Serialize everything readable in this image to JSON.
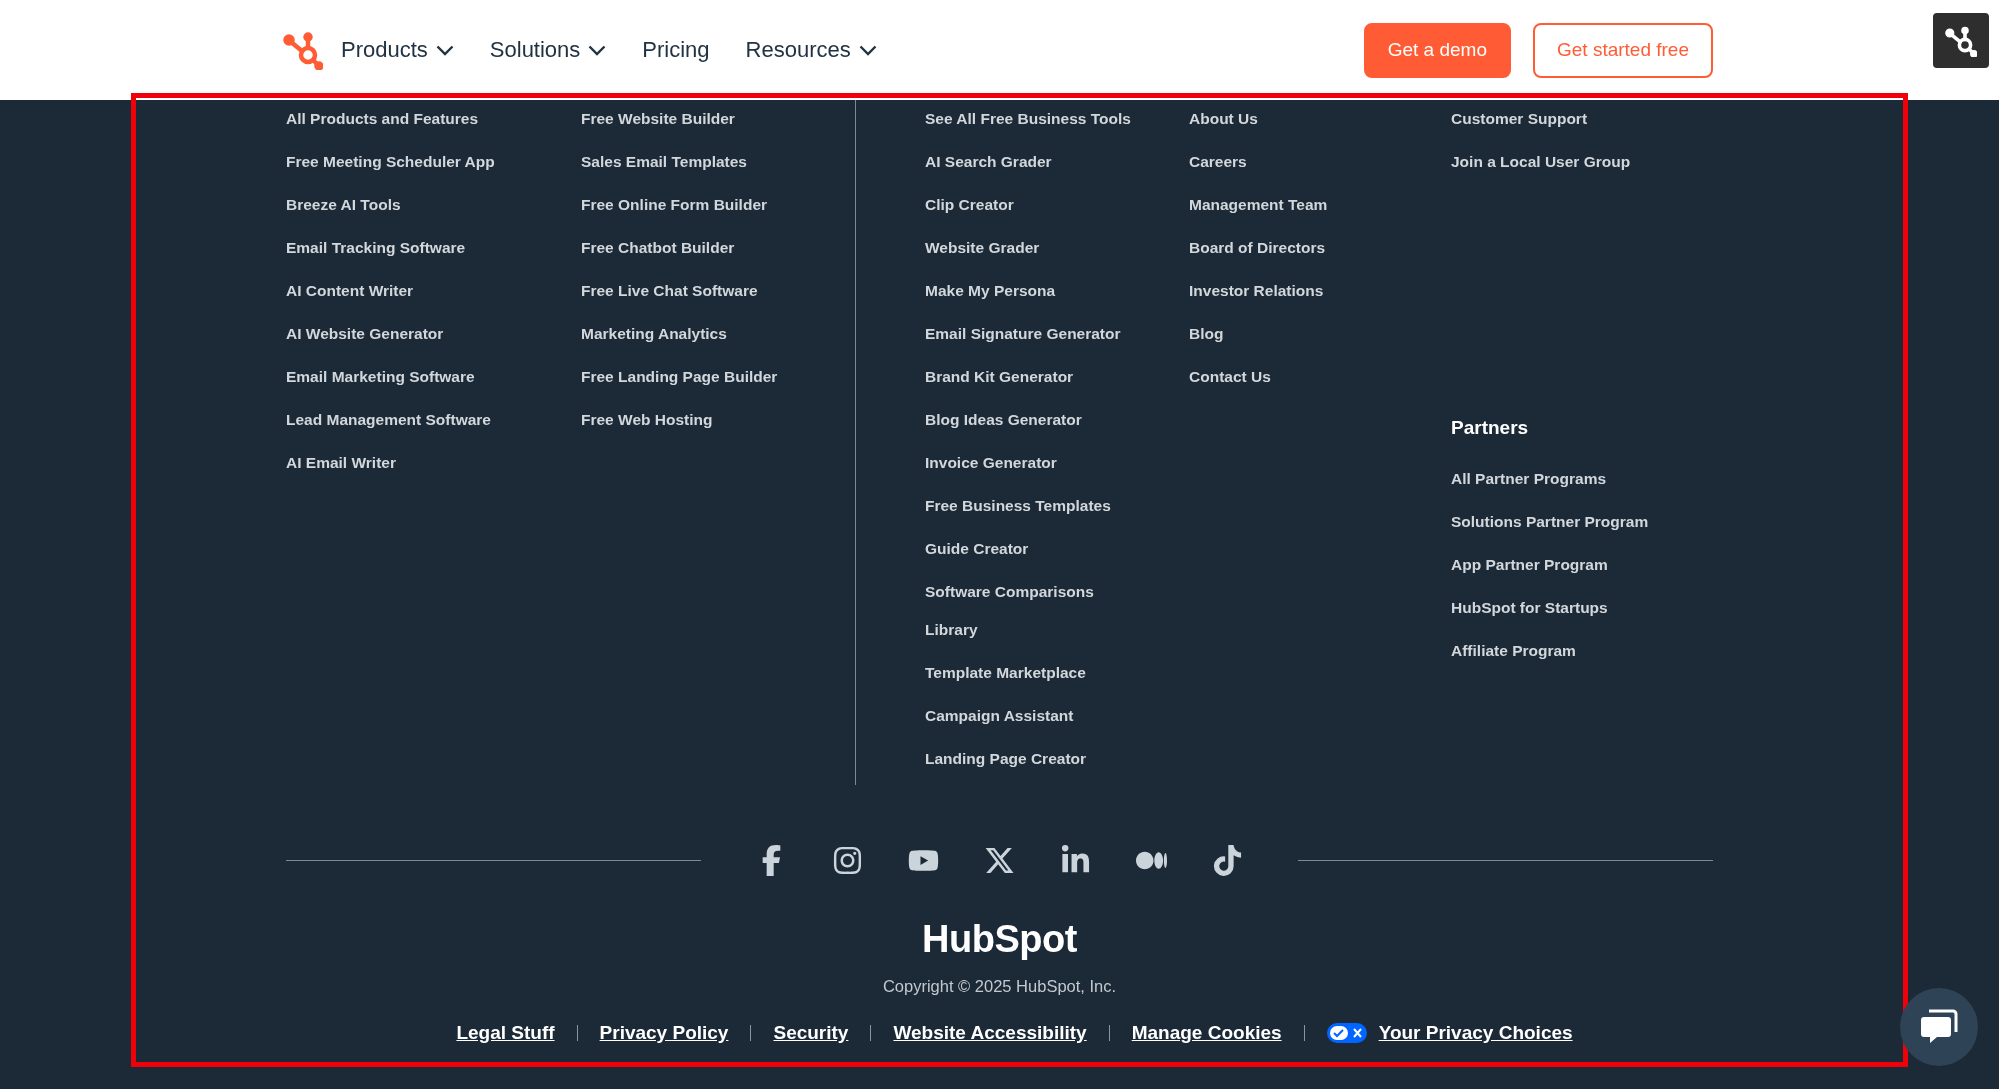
{
  "header": {
    "nav": [
      {
        "label": "Products",
        "dropdown": true
      },
      {
        "label": "Solutions",
        "dropdown": true
      },
      {
        "label": "Pricing",
        "dropdown": false
      },
      {
        "label": "Resources",
        "dropdown": true
      }
    ],
    "buttons": [
      {
        "label": "Get a demo",
        "kind": "primary"
      },
      {
        "label": "Get started free",
        "kind": "outline"
      }
    ]
  },
  "footer": {
    "columns": [
      {
        "sections": [
          {
            "links": [
              "All Products and Features",
              "Free Meeting Scheduler App",
              "Breeze AI Tools",
              "Email Tracking Software",
              "AI Content Writer",
              "AI Website Generator",
              "Email Marketing Software",
              "Lead Management Software",
              "AI Email Writer"
            ]
          }
        ]
      },
      {
        "sections": [
          {
            "links": [
              "Free Website Builder",
              "Sales Email Templates",
              "Free Online Form Builder",
              "Free Chatbot Builder",
              "Free Live Chat Software",
              "Marketing Analytics",
              "Free Landing Page Builder",
              "Free Web Hosting"
            ]
          }
        ]
      },
      {
        "sections": [
          {
            "links": [
              "See All Free Business Tools",
              "AI Search Grader",
              "Clip Creator",
              "Website Grader",
              "Make My Persona",
              "Email Signature Generator",
              "Brand Kit Generator",
              "Blog Ideas Generator",
              "Invoice Generator",
              "Free Business Templates",
              "Guide Creator",
              "Software Comparisons Library",
              "Template Marketplace",
              "Campaign Assistant",
              "Landing Page Creator"
            ]
          }
        ]
      },
      {
        "sections": [
          {
            "links": [
              "About Us",
              "Careers",
              "Management Team",
              "Board of Directors",
              "Investor Relations",
              "Blog",
              "Contact Us"
            ]
          }
        ]
      },
      {
        "sections": [
          {
            "links": [
              "Customer Support",
              "Join a Local User Group"
            ]
          },
          {
            "heading": "Partners",
            "links": [
              "All Partner Programs",
              "Solutions Partner Program",
              "App Partner Program",
              "HubSpot for Startups",
              "Affiliate Program"
            ]
          }
        ]
      }
    ],
    "social": [
      {
        "kind": "facebook"
      },
      {
        "kind": "instagram"
      },
      {
        "kind": "youtube"
      },
      {
        "kind": "x"
      },
      {
        "kind": "linkedin"
      },
      {
        "kind": "medium"
      },
      {
        "kind": "tiktok"
      }
    ],
    "logo_text": "HubSpot",
    "copyright": "Copyright © 2025 HubSpot, Inc.",
    "legal_links": [
      "Legal Stuff",
      "Privacy Policy",
      "Security",
      "Website Accessibility",
      "Manage Cookies"
    ],
    "privacy_choices": "Your Privacy Choices"
  }
}
